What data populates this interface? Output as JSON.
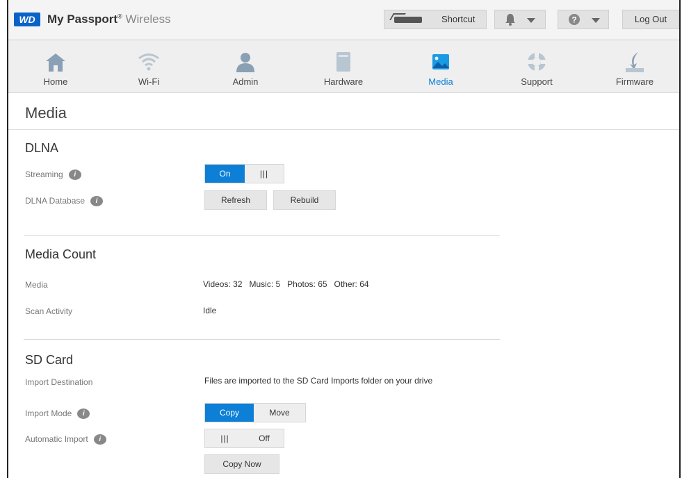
{
  "header": {
    "logo": "WD",
    "brand_bold": "My Passport",
    "brand_reg": "®",
    "brand_light": "Wireless",
    "shortcut_label": "Shortcut",
    "logout_label": "Log Out"
  },
  "nav": [
    {
      "label": "Home",
      "icon": "home-icon"
    },
    {
      "label": "Wi-Fi",
      "icon": "wifi-icon"
    },
    {
      "label": "Admin",
      "icon": "user-icon"
    },
    {
      "label": "Hardware",
      "icon": "hardware-icon"
    },
    {
      "label": "Media",
      "icon": "media-icon",
      "active": true
    },
    {
      "label": "Support",
      "icon": "lifebuoy-icon"
    },
    {
      "label": "Firmware",
      "icon": "firmware-icon"
    }
  ],
  "page": {
    "title": "Media"
  },
  "dlna": {
    "heading": "DLNA",
    "streaming_label": "Streaming",
    "streaming_on": "On",
    "database_label": "DLNA Database",
    "refresh_label": "Refresh",
    "rebuild_label": "Rebuild"
  },
  "media_count": {
    "heading": "Media Count",
    "media_label": "Media",
    "media_value": "Videos: 32   Music: 5   Photos: 65   Other: 64",
    "scan_label": "Scan Activity",
    "scan_value": "Idle"
  },
  "sd_card": {
    "heading": "SD Card",
    "dest_label": "Import Destination",
    "dest_value": "Files are imported to the SD Card Imports folder on your drive",
    "mode_label": "Import Mode",
    "mode_copy": "Copy",
    "mode_move": "Move",
    "auto_label": "Automatic Import",
    "auto_off": "Off",
    "copy_now_label": "Copy Now"
  },
  "info_glyph": "i",
  "grip_glyph": "|||",
  "colors": {
    "accent": "#0d7fd6",
    "logo_blue": "#0a62c9"
  }
}
